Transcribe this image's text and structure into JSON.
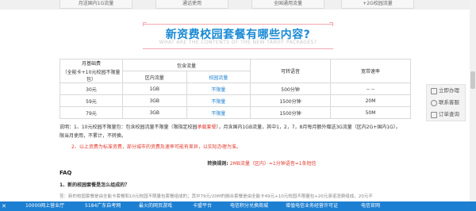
{
  "top_strip": {
    "cells": [
      "月送国内1G流量",
      "通话使用",
      "全国通用流量",
      "+2G校园流量"
    ]
  },
  "heading": {
    "title": "新资费校园套餐有哪些内容?",
    "subtitle": "WHAT ARE THE CONTENTS OF THE NEW TARIFF PACKAGES?"
  },
  "table": {
    "h_base": "月基础费",
    "h_base_note": "（全能卡+10元校园不限量包）",
    "h_package": "包含流量",
    "h_domestic": "区内流量",
    "h_campus": "校园流量",
    "h_voice": "可转语音",
    "h_speed": "宽带速率",
    "rows": [
      {
        "fee": "30元",
        "domestic": "1GB",
        "campus": "不限量",
        "voice": "500分钟",
        "speed": "-- --"
      },
      {
        "fee": "59元",
        "domestic": "3GB",
        "campus": "不限量",
        "voice": "1500分钟",
        "speed": "20M"
      },
      {
        "fee": "79元",
        "domestic": "3GB",
        "campus": "不限量",
        "voice": "1500分钟",
        "speed": "50M"
      }
    ]
  },
  "notes": {
    "note1_a": "说明：1、10元校园不限量包：包含校园流量不限量（限指定校园",
    "note1_red": "承载套餐",
    "note1_b": "），月含国内1GB流量，其中1，2，7，8月每月额外赠送3G流量（区内2G+国内1G）。",
    "note1_c": "限当月使用，不累计，不转换。",
    "note2": "2、以上资费为标准资费，部分城市的资费及速率可能有差异，以实际办理为准。",
    "rule_label": "转换规则:",
    "rule_text": "2MB流量（区内）=1分钟语音=1条短信"
  },
  "faq": {
    "title": "FAQ",
    "q1": "1、新的校园套餐是怎么组成的？",
    "a1": "答：新的校园套餐是由全能卡套餐和10元校园不限量包套餐组成的；其中79元/20M的融合套餐是由全能卡49元+10元校园不限量包+20元承诺消费组成，20元不"
  },
  "float_panel": {
    "items": [
      {
        "label": "立即办理",
        "icon": "edit-icon"
      },
      {
        "label": "联系客服",
        "icon": "customer-service-icon"
      },
      {
        "label": "订单查询",
        "icon": "search-icon"
      }
    ]
  },
  "bottom_bar": {
    "close": "✕",
    "items": [
      "10000网上营业厅",
      "5184广东自考网",
      "最火的网页游戏",
      "卡盟平台",
      "电信积分兑换商城",
      "增值电信业务经营许可证",
      "电信官网"
    ]
  },
  "colors": {
    "accent": "#1a8ad4",
    "bar": "#1d7fd1",
    "highlight": "#e03a2e",
    "heading_rule": "#f4a8b4"
  }
}
